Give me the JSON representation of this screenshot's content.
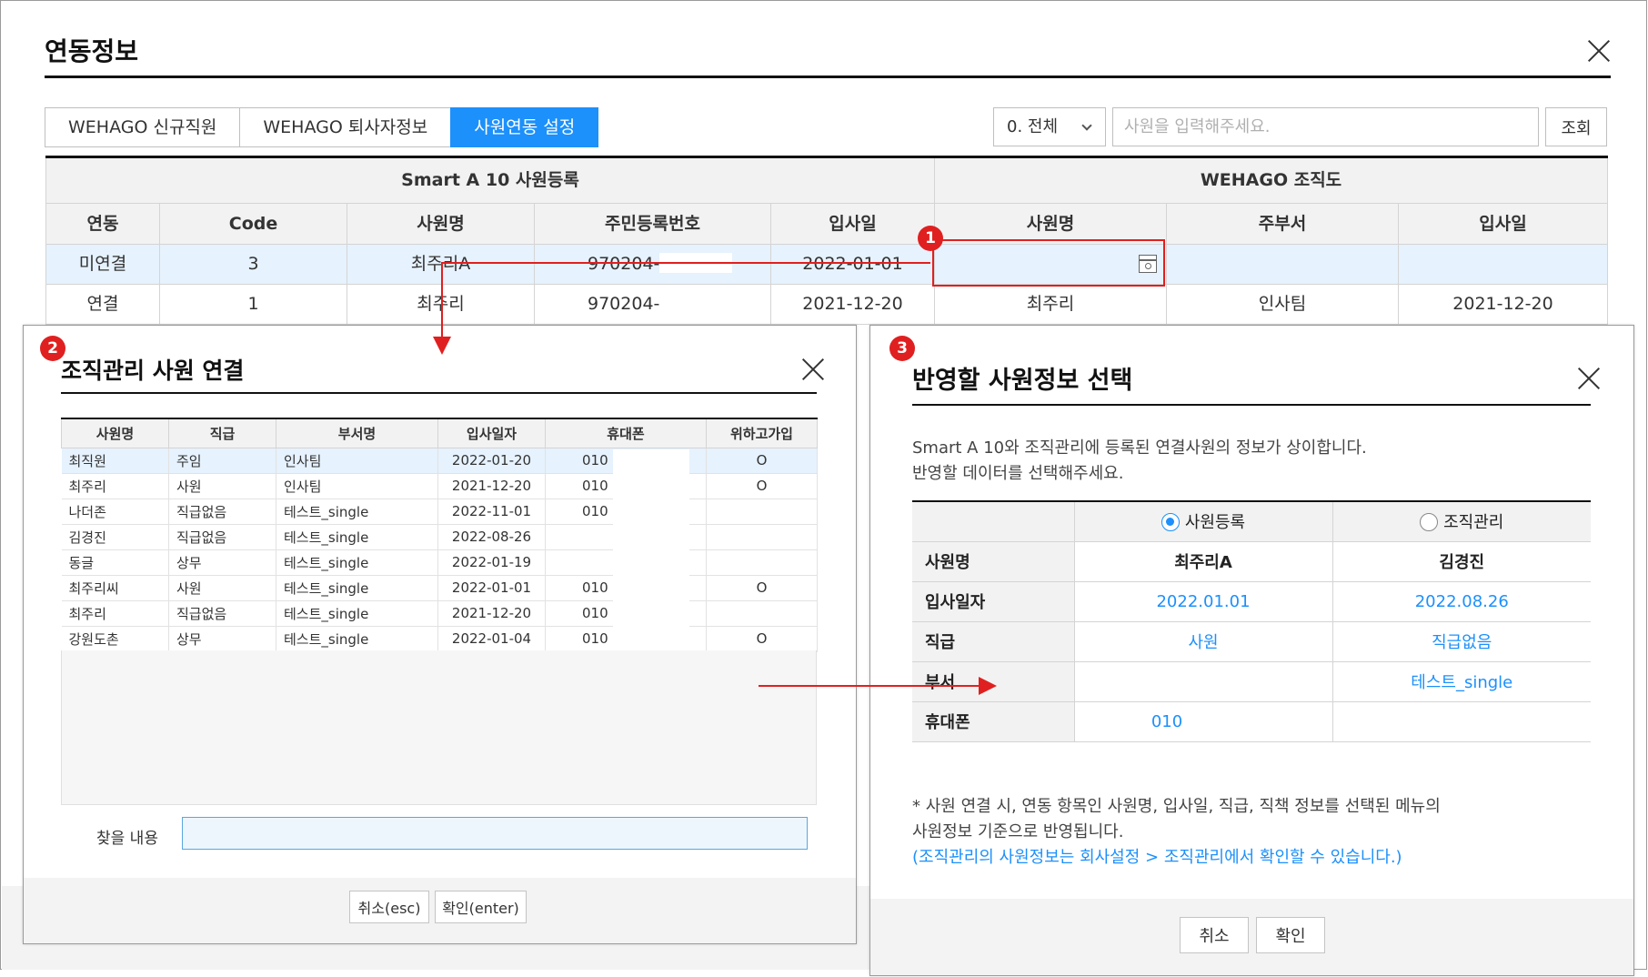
{
  "main": {
    "title": "연동정보",
    "tabs": [
      "WEHAGO 신규직원",
      "WEHAGO 퇴사자정보",
      "사원연동 설정"
    ],
    "filter_value": "0. 전체",
    "search_placeholder": "사원을 입력해주세요.",
    "search_button": "조회",
    "groups": [
      "Smart A 10 사원등록",
      "WEHAGO 조직도"
    ],
    "columns": [
      "연동",
      "Code",
      "사원명",
      "주민등록번호",
      "입사일",
      "사원명",
      "주부서",
      "입사일"
    ],
    "rows": [
      {
        "link": "미연결",
        "code": "3",
        "name": "최주리A",
        "rrn": "970204-",
        "date": "2022-01-01",
        "w_name": "",
        "w_dept": "",
        "w_date": ""
      },
      {
        "link": "연결",
        "code": "1",
        "name": "최주리",
        "rrn": "970204-",
        "date": "2021-12-20",
        "w_name": "최주리",
        "w_dept": "인사팀",
        "w_date": "2021-12-20"
      }
    ]
  },
  "badges": [
    "1",
    "2",
    "3"
  ],
  "link_dialog": {
    "title": "조직관리 사원 연결",
    "columns": [
      "사원명",
      "직급",
      "부서명",
      "입사일자",
      "휴대폰",
      "위하고가입"
    ],
    "rows": [
      {
        "name": "최직원",
        "rank": "주임",
        "dept": "인사팀",
        "date": "2022-01-20",
        "phone": "010",
        "joined": "O"
      },
      {
        "name": "최주리",
        "rank": "사원",
        "dept": "인사팀",
        "date": "2021-12-20",
        "phone": "010",
        "joined": "O"
      },
      {
        "name": "나더존",
        "rank": "직급없음",
        "dept": "테스트_single",
        "date": "2022-11-01",
        "phone": "010",
        "joined": ""
      },
      {
        "name": "김경진",
        "rank": "직급없음",
        "dept": "테스트_single",
        "date": "2022-08-26",
        "phone": "",
        "joined": ""
      },
      {
        "name": "동글",
        "rank": "상무",
        "dept": "테스트_single",
        "date": "2022-01-19",
        "phone": "",
        "joined": ""
      },
      {
        "name": "최주리씨",
        "rank": "사원",
        "dept": "테스트_single",
        "date": "2022-01-01",
        "phone": "010",
        "joined": "O"
      },
      {
        "name": "최주리",
        "rank": "직급없음",
        "dept": "테스트_single",
        "date": "2021-12-20",
        "phone": "010",
        "joined": ""
      },
      {
        "name": "강원도촌",
        "rank": "상무",
        "dept": "테스트_single",
        "date": "2022-01-04",
        "phone": "010",
        "joined": "O"
      }
    ],
    "find_label": "찾을 내용",
    "cancel": "취소(esc)",
    "confirm": "확인(enter)"
  },
  "select_dialog": {
    "title": "반영할 사원정보 선택",
    "message_line1": "Smart A 10와 조직관리에 등록된 연결사원의 정보가 상이합니다.",
    "message_line2": "반영할 데이터를 선택해주세요.",
    "option_a": "사원등록",
    "option_b": "조직관리",
    "rows": [
      {
        "label": "사원명",
        "a": "최주리A",
        "b": "김경진"
      },
      {
        "label": "입사일자",
        "a": "2022.01.01",
        "b": "2022.08.26"
      },
      {
        "label": "직급",
        "a": "사원",
        "b": "직급없음"
      },
      {
        "label": "부서",
        "a": "",
        "b": "테스트_single"
      },
      {
        "label": "휴대폰",
        "a": "010",
        "b": ""
      }
    ],
    "note_line1": "* 사원 연결 시, 연동 항목인 사원명, 입사일, 직급, 직책 정보를 선택된 메뉴의",
    "note_line2": "사원정보 기준으로 반영됩니다.",
    "note_line3": "(조직관리의 사원정보는 회사설정 > 조직관리에서 확인할 수 있습니다.)",
    "cancel": "취소",
    "confirm": "확인"
  },
  "colors": {
    "accent": "#1c90fb",
    "annotation": "#e02020",
    "unlinked": "#e02020",
    "linked": "#1a53d6"
  }
}
